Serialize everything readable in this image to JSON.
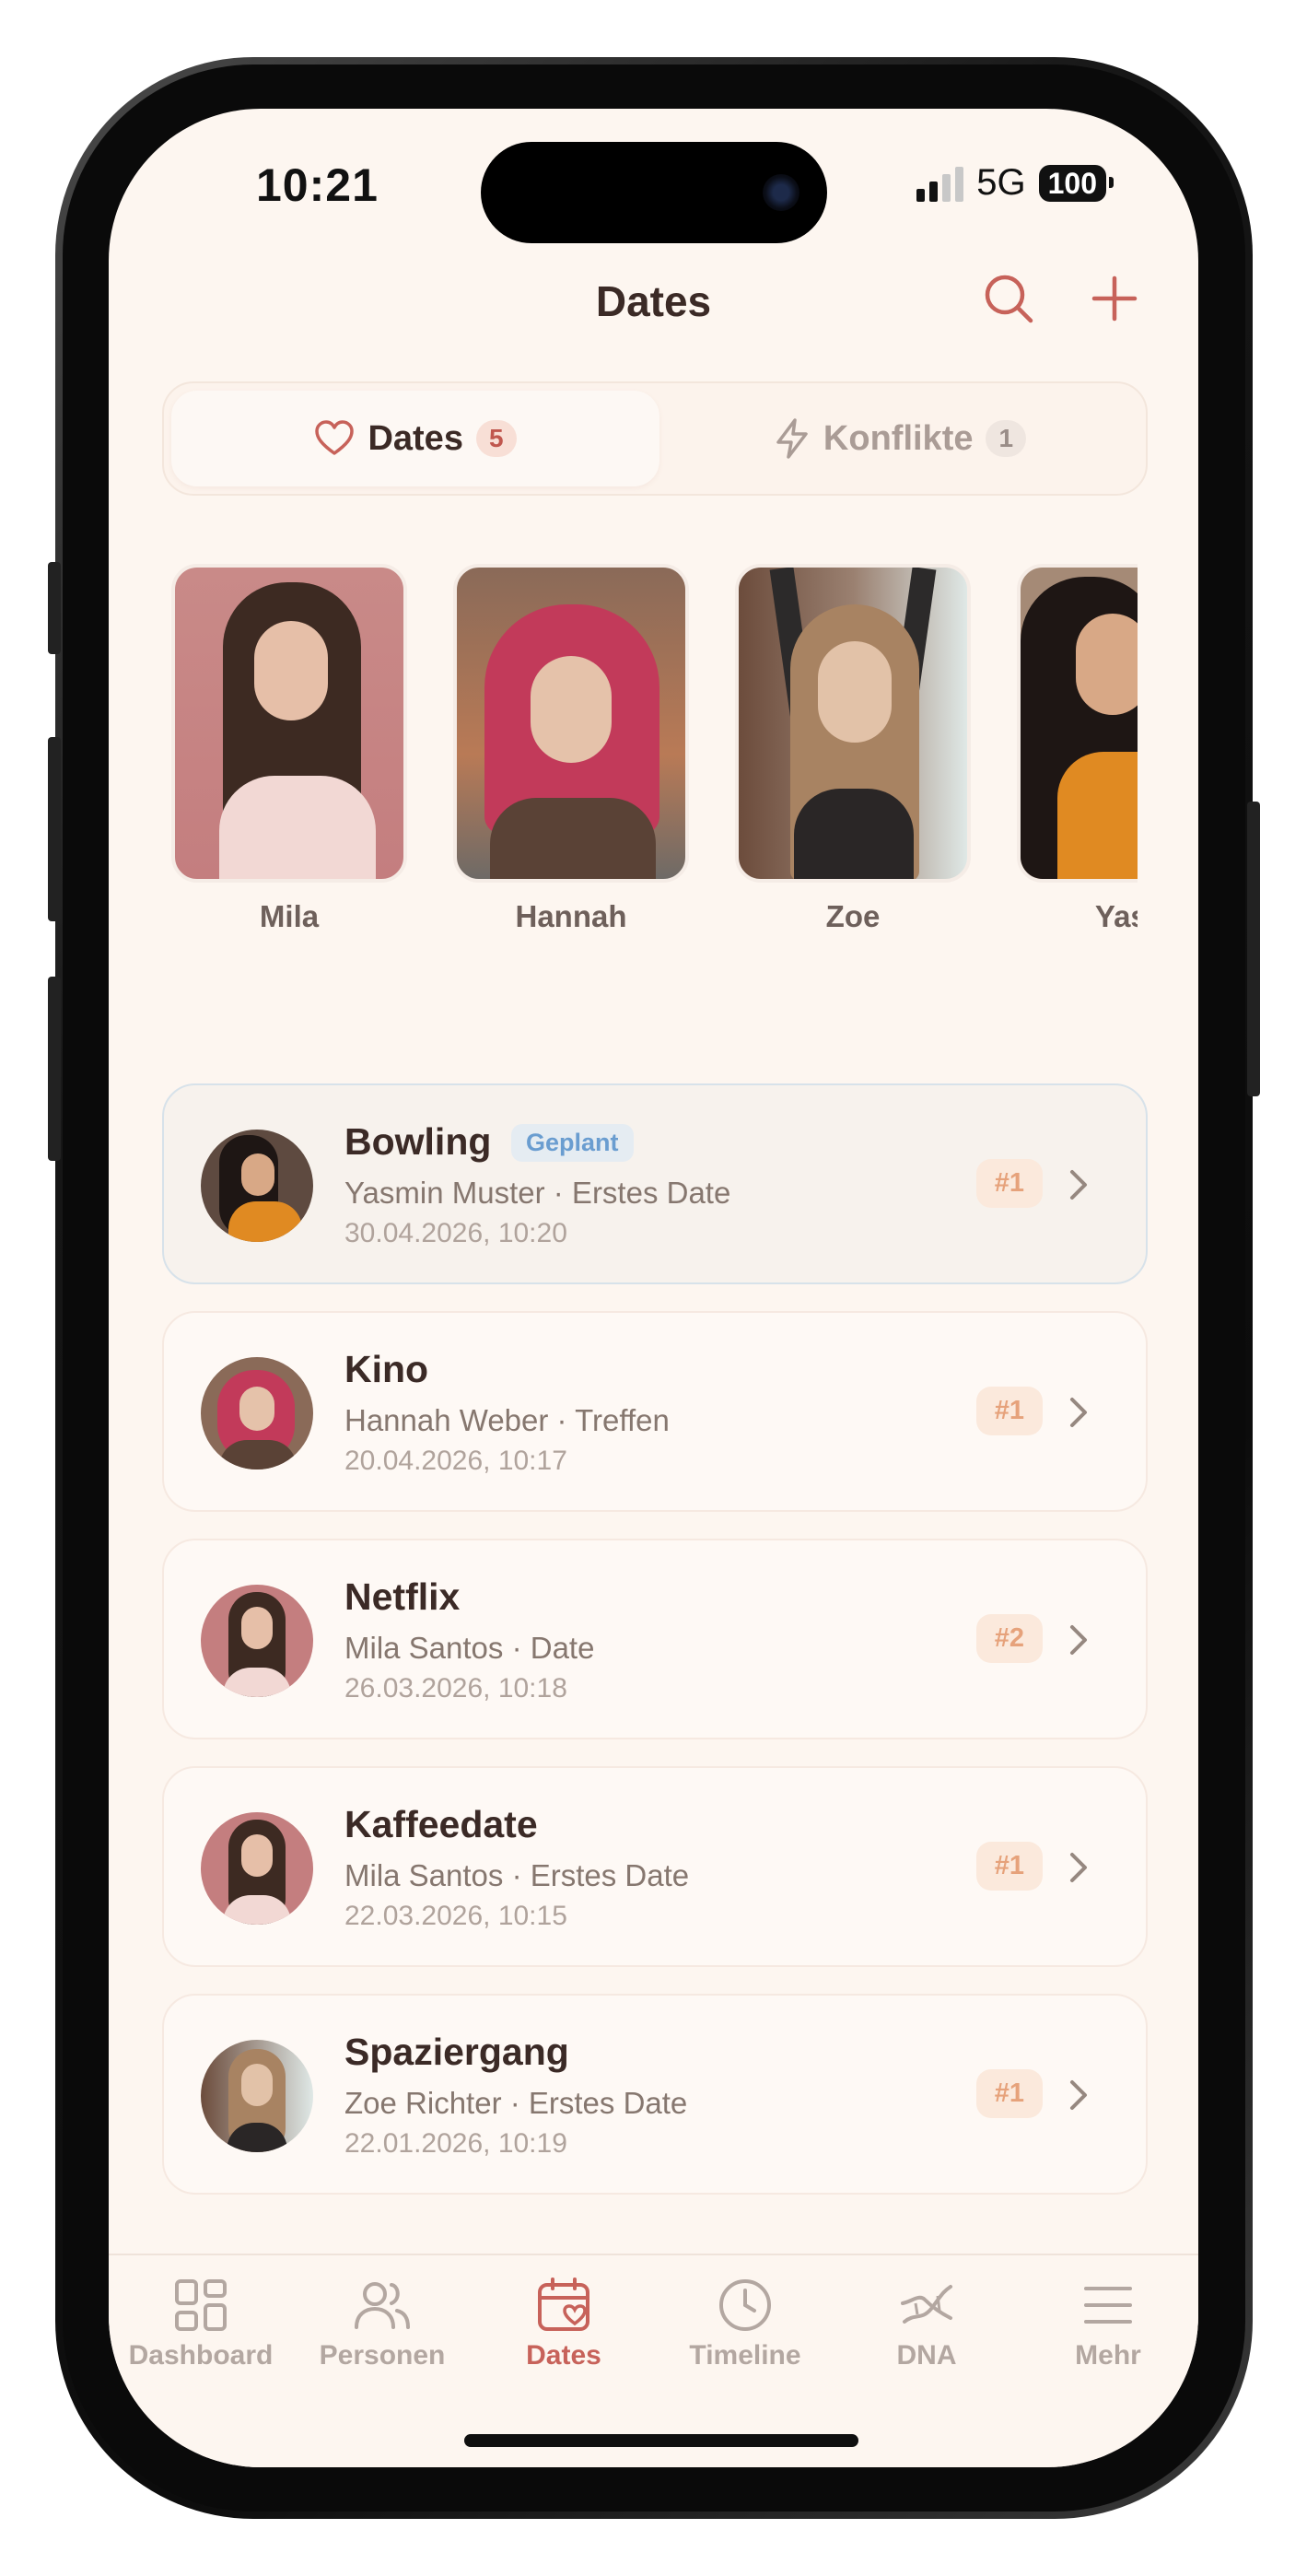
{
  "status_bar": {
    "time": "10:21",
    "network": "5G",
    "battery": "100"
  },
  "header": {
    "title": "Dates",
    "search_icon": "search-icon",
    "add_icon": "plus-icon"
  },
  "segments": [
    {
      "label": "Dates",
      "count": "5",
      "icon": "heart-icon",
      "active": true
    },
    {
      "label": "Konflikte",
      "count": "1",
      "icon": "lightning-icon",
      "active": false
    }
  ],
  "people": [
    {
      "name": "Mila"
    },
    {
      "name": "Hannah"
    },
    {
      "name": "Zoe"
    },
    {
      "name": "Yasm"
    }
  ],
  "dates": [
    {
      "title": "Bowling",
      "tag": "Geplant",
      "subtitle": "Yasmin Muster · Erstes Date",
      "datetime": "30.04.2026, 10:20",
      "rank": "#1"
    },
    {
      "title": "Kino",
      "subtitle": "Hannah Weber · Treffen",
      "datetime": "20.04.2026, 10:17",
      "rank": "#1"
    },
    {
      "title": "Netflix",
      "subtitle": "Mila Santos · Date",
      "datetime": "26.03.2026, 10:18",
      "rank": "#2"
    },
    {
      "title": "Kaffeedate",
      "subtitle": "Mila Santos · Erstes Date",
      "datetime": "22.03.2026, 10:15",
      "rank": "#1"
    },
    {
      "title": "Spaziergang",
      "subtitle": "Zoe Richter · Erstes Date",
      "datetime": "22.01.2026, 10:19",
      "rank": "#1"
    }
  ],
  "tabbar": [
    {
      "label": "Dashboard",
      "icon": "grid-icon"
    },
    {
      "label": "Personen",
      "icon": "people-icon"
    },
    {
      "label": "Dates",
      "icon": "calendar-heart-icon",
      "active": true
    },
    {
      "label": "Timeline",
      "icon": "clock-icon"
    },
    {
      "label": "DNA",
      "icon": "dna-icon"
    },
    {
      "label": "Mehr",
      "icon": "menu-icon"
    }
  ],
  "colors": {
    "accent": "#c7625a",
    "background": "#fdf6f0",
    "tag_blue": "#6a9dd0",
    "rank_orange": "#e6a27b"
  }
}
